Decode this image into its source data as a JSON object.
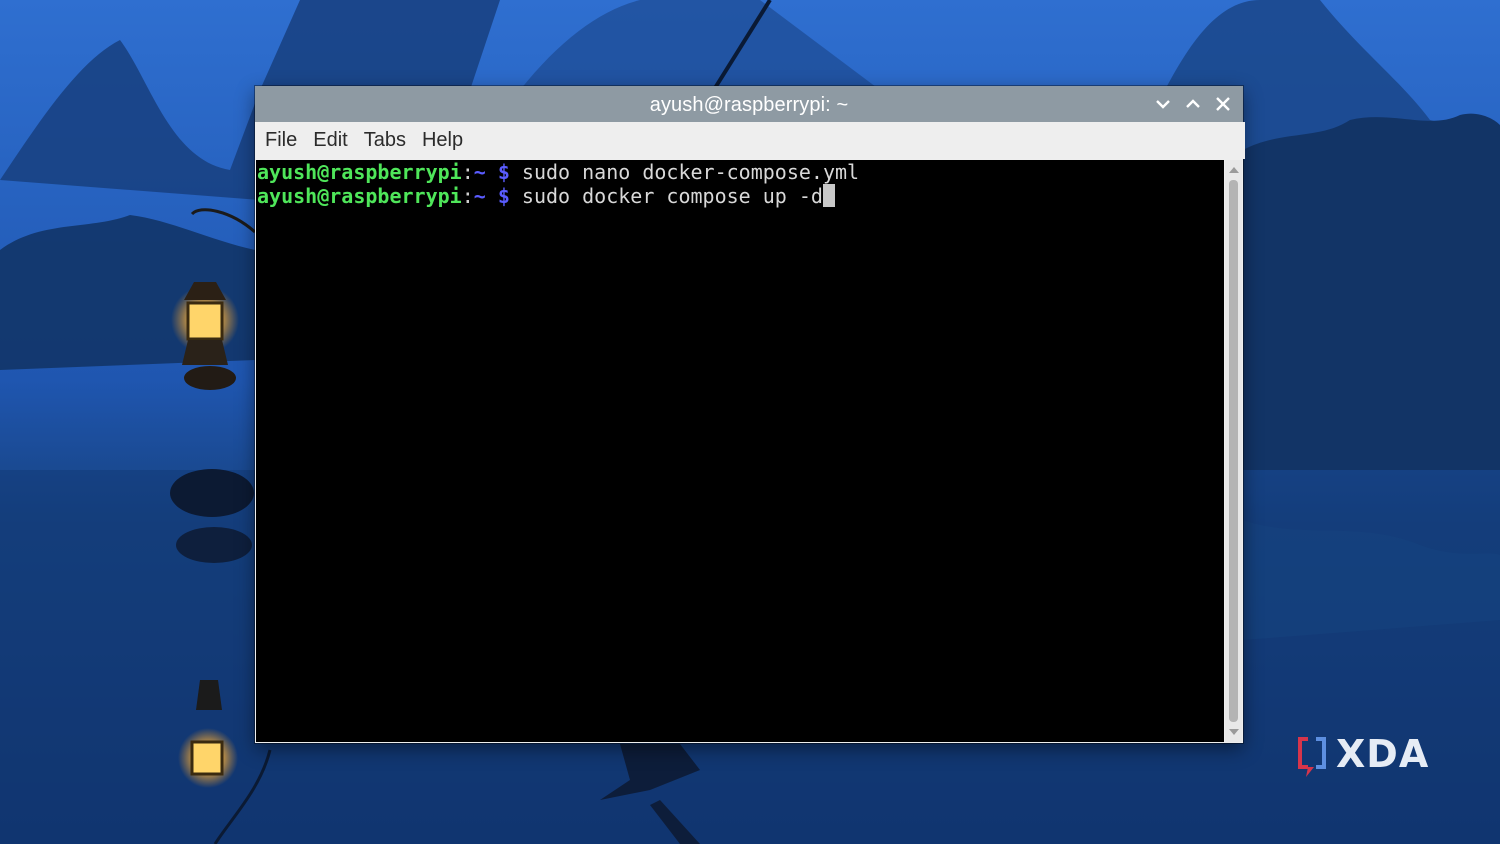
{
  "window": {
    "title": "ayush@raspberrypi: ~",
    "controls": [
      "minimize-icon",
      "maximize-icon",
      "close-icon"
    ]
  },
  "menu": {
    "items": [
      "File",
      "Edit",
      "Tabs",
      "Help"
    ]
  },
  "terminal": {
    "lines": [
      {
        "user_host": "ayush@raspberrypi",
        "colon": ":",
        "path": "~",
        "dollar": " $ ",
        "command": "sudo nano docker-compose.yml"
      },
      {
        "user_host": "ayush@raspberrypi",
        "colon": ":",
        "path": "~",
        "dollar": " $ ",
        "command": "sudo docker compose up -d"
      }
    ],
    "colors": {
      "background": "#000000",
      "user_host": "#4fe65a",
      "path": "#5a5cff",
      "command": "#d8d8d8"
    }
  },
  "watermark": {
    "brand": "XDA",
    "accent": "#d6354b"
  }
}
